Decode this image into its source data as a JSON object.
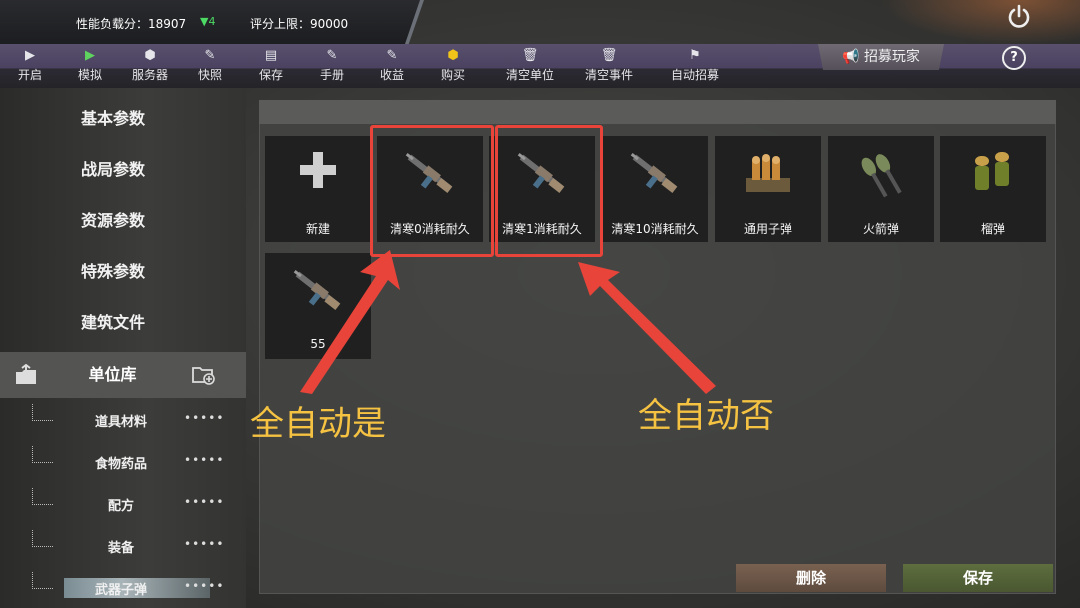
{
  "status": {
    "perf_label": "性能负载分：18907",
    "perf_delta": "▼4",
    "score_limit": "评分上限：90000"
  },
  "toolbar": {
    "items": [
      {
        "label": "开启",
        "icon": "play-icon"
      },
      {
        "label": "模拟",
        "icon": "play-green-icon"
      },
      {
        "label": "服务器",
        "icon": "cube-icon"
      },
      {
        "label": "快照",
        "icon": "edit-icon"
      },
      {
        "label": "保存",
        "icon": "document-icon"
      },
      {
        "label": "手册",
        "icon": "edit-icon"
      },
      {
        "label": "收益",
        "icon": "edit-icon"
      },
      {
        "label": "购买",
        "icon": "cube-yellow-icon"
      },
      {
        "label": "清空单位",
        "icon": "trash-icon"
      },
      {
        "label": "清空事件",
        "icon": "trash-icon"
      },
      {
        "label": "自动招募",
        "icon": "flag-icon"
      }
    ],
    "recruit_label": "招募玩家",
    "help_label": "?"
  },
  "sidebar": {
    "items": [
      "基本参数",
      "战局参数",
      "资源参数",
      "特殊参数",
      "建筑文件"
    ],
    "unit_lib": "单位库",
    "sub_items": [
      "道具材料",
      "食物药品",
      "配方",
      "装备",
      "武器子弹"
    ],
    "sub_dots": "•••••"
  },
  "cards": [
    {
      "label": "新建",
      "icon": "plus-icon"
    },
    {
      "label": "清寒0消耗耐久",
      "icon": "rifle-icon"
    },
    {
      "label": "清寒1消耗耐久",
      "icon": "rifle-icon"
    },
    {
      "label": "清寒10消耗耐久",
      "icon": "rifle-icon"
    },
    {
      "label": "通用子弹",
      "icon": "bullets-icon"
    },
    {
      "label": "火箭弹",
      "icon": "rocket-icon"
    },
    {
      "label": "榴弹",
      "icon": "grenade-icon"
    },
    {
      "label": "55",
      "icon": "rifle-icon"
    }
  ],
  "annotations": {
    "left": "全自动是",
    "right": "全自动否"
  },
  "buttons": {
    "delete": "删除",
    "save": "保存"
  },
  "colors": {
    "accent_red": "#e8443a",
    "annotation_yellow": "#f5c242",
    "toolbar_purple": "#4a4260"
  }
}
